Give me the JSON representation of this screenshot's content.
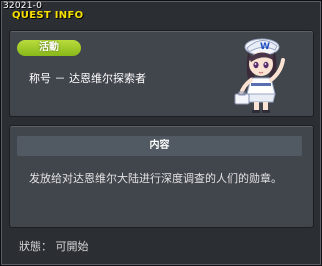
{
  "quest": {
    "id": "32021-0",
    "window_title": "QUEST INFO",
    "badge": "活動",
    "name": "称号 － 达恩维尔探索者",
    "section_title": "内容",
    "description": "发放给对达恩维尔大陆进行深度调查的人们的勋章。",
    "status": "狀態： 可開始"
  },
  "colors": {
    "accent_title": "#f7e000",
    "badge_green": "#9ccb24",
    "panel_bg": "#41454c"
  },
  "icons": [
    "npc-character-icon"
  ]
}
